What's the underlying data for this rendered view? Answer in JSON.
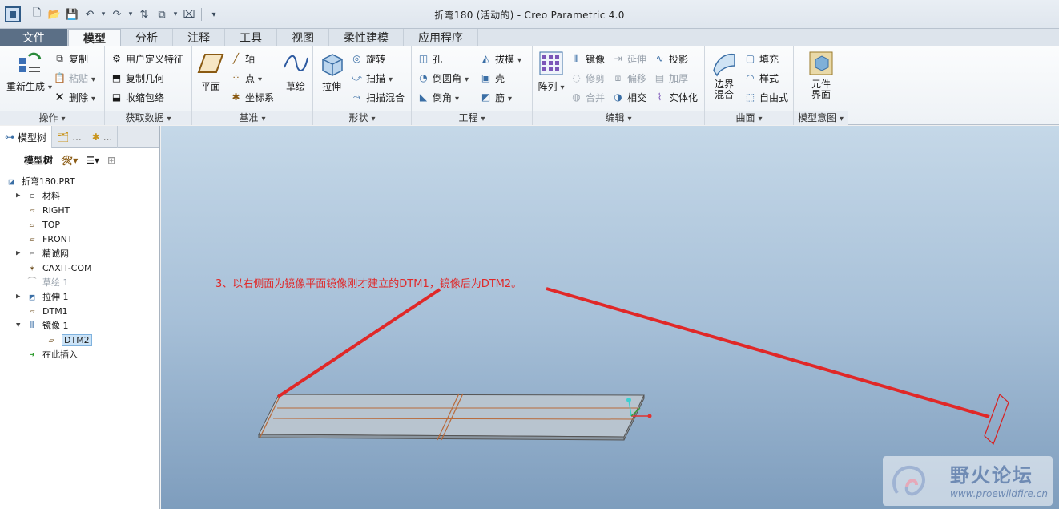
{
  "window": {
    "title": "折弯180 (活动的) - Creo Parametric 4.0"
  },
  "tabs": [
    "文件",
    "模型",
    "分析",
    "注释",
    "工具",
    "视图",
    "柔性建模",
    "应用程序"
  ],
  "ribbon": {
    "operations": {
      "label": "操作",
      "regenerate": "重新生成",
      "copy": "复制",
      "paste": "粘贴",
      "delete": "删除"
    },
    "get_data": {
      "label": "获取数据",
      "udf": "用户定义特征",
      "copy_geom": "复制几何",
      "shrinkwrap": "收缩包络"
    },
    "datum": {
      "label": "基准",
      "plane": "平面",
      "axis": "轴",
      "point": "点",
      "csys": "坐标系",
      "sketch": "草绘"
    },
    "shapes": {
      "label": "形状",
      "extrude": "拉伸",
      "revolve": "旋转",
      "sweep": "扫描",
      "swept_blend": "扫描混合"
    },
    "engineering": {
      "label": "工程",
      "hole": "孔",
      "draft": "拔模",
      "round": "倒圆角",
      "shell": "壳",
      "chamfer": "倒角",
      "rib": "筋"
    },
    "editing": {
      "label": "编辑",
      "pattern": "阵列",
      "mirror": "镜像",
      "extend": "延伸",
      "project": "投影",
      "trim": "修剪",
      "offset": "偏移",
      "thicken": "加厚",
      "merge": "合并",
      "intersect": "相交",
      "solidify": "实体化"
    },
    "surfaces": {
      "label": "曲面",
      "boundary_blend": "边界混合",
      "fill": "填充",
      "style": "样式",
      "freestyle": "自由式"
    },
    "model_intent": {
      "label": "模型意图",
      "component_interface": "元件界面"
    }
  },
  "left_panel": {
    "tabs": [
      "模型树",
      "...",
      "..."
    ],
    "toolbar_label": "模型树",
    "tree": [
      {
        "label": "折弯180.PRT",
        "icon": "part-icon",
        "expand": false,
        "level": 0
      },
      {
        "label": "材料",
        "icon": "material-icon",
        "expand": true,
        "level": 1
      },
      {
        "label": "RIGHT",
        "icon": "datum-plane-icon",
        "expand": false,
        "level": 1
      },
      {
        "label": "TOP",
        "icon": "datum-plane-icon",
        "expand": false,
        "level": 1
      },
      {
        "label": "FRONT",
        "icon": "datum-plane-icon",
        "expand": false,
        "level": 1
      },
      {
        "label": "精诚网",
        "icon": "mesh-icon",
        "expand": true,
        "level": 1
      },
      {
        "label": "CAXIT-COM",
        "icon": "csys-icon",
        "expand": false,
        "level": 1
      },
      {
        "label": "草绘 1",
        "icon": "sketch-icon",
        "expand": false,
        "level": 1,
        "faded": true
      },
      {
        "label": "拉伸 1",
        "icon": "extrude-icon",
        "expand": true,
        "level": 1
      },
      {
        "label": "DTM1",
        "icon": "datum-plane-icon",
        "expand": false,
        "level": 1
      },
      {
        "label": "镜像 1",
        "icon": "mirror-icon",
        "expand": "open",
        "level": 1
      },
      {
        "label": "DTM2",
        "icon": "datum-plane-icon",
        "expand": false,
        "level": 2,
        "selected": true
      },
      {
        "label": "在此插入",
        "icon": "insert-here-icon",
        "expand": false,
        "level": 1
      }
    ]
  },
  "viewport": {
    "annotation": "3、以右侧面为镜像平面镜像刚才建立的DTM1，镜像后为DTM2。",
    "annotation_color": "#e02828",
    "background_top": "#c5d8e8",
    "background_bottom": "#7e9dbd"
  },
  "watermark": {
    "title": "野火论坛",
    "url": "www.proewildfire.cn"
  }
}
